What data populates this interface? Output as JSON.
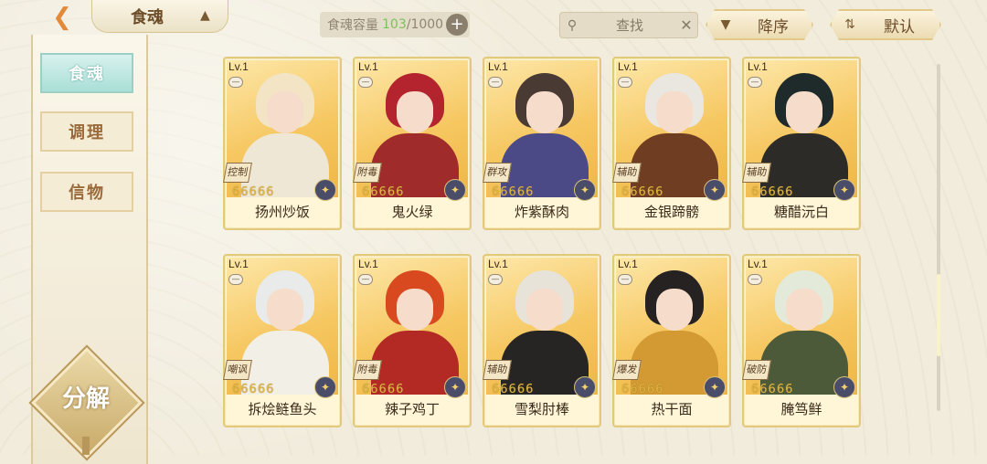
{
  "header": {
    "back_icon": "back-arrow-icon",
    "title": "食魂",
    "capacity_label": "食魂容量",
    "capacity_current": "103",
    "capacity_max": "/1000",
    "capacity_plus": "+",
    "search_label": "查找",
    "search_close": "✕",
    "sort_order_label": "降序",
    "sort_mode_label": "默认"
  },
  "sidebar": {
    "items": [
      {
        "label": "食魂",
        "active": true
      },
      {
        "label": "调理",
        "active": false
      },
      {
        "label": "信物",
        "active": false
      }
    ],
    "decompose_label": "分解"
  },
  "cards": [
    {
      "level": "Lv.1",
      "role": "控制",
      "name": "扬州炒饭",
      "stars": "66666",
      "hair": "#f2e4c4",
      "body": "#efe7d6"
    },
    {
      "level": "Lv.1",
      "role": "附毒",
      "name": "鬼火绿",
      "stars": "66666",
      "hair": "#b3242f",
      "body": "#9f2b2b"
    },
    {
      "level": "Lv.1",
      "role": "群攻",
      "name": "炸紫酥肉",
      "stars": "66666",
      "hair": "#4a3a34",
      "body": "#4b4a86"
    },
    {
      "level": "Lv.1",
      "role": "辅助",
      "name": "金银蹄髈",
      "stars": "66666",
      "hair": "#eae6e0",
      "body": "#6e3d22"
    },
    {
      "level": "Lv.1",
      "role": "辅助",
      "name": "糖醋沅白",
      "stars": "66666",
      "hair": "#1f2a2a",
      "body": "#2d2b28"
    },
    {
      "level": "Lv.1",
      "role": "嘲讽",
      "name": "拆烩鲢鱼头",
      "stars": "66666",
      "hair": "#e9ebea",
      "body": "#f2efe6"
    },
    {
      "level": "Lv.1",
      "role": "附毒",
      "name": "辣子鸡丁",
      "stars": "66666",
      "hair": "#d9491f",
      "body": "#b32a25"
    },
    {
      "level": "Lv.1",
      "role": "辅助",
      "name": "雪梨肘棒",
      "stars": "66666",
      "hair": "#e7e3d8",
      "body": "#262524"
    },
    {
      "level": "Lv.1",
      "role": "爆发",
      "name": "热干面",
      "stars": "66666",
      "hair": "#262222",
      "body": "#d39a33"
    },
    {
      "level": "Lv.1",
      "role": "破防",
      "name": "腌笃鲜",
      "stars": "66666",
      "hair": "#e3ead9",
      "body": "#4d5a3a"
    }
  ]
}
